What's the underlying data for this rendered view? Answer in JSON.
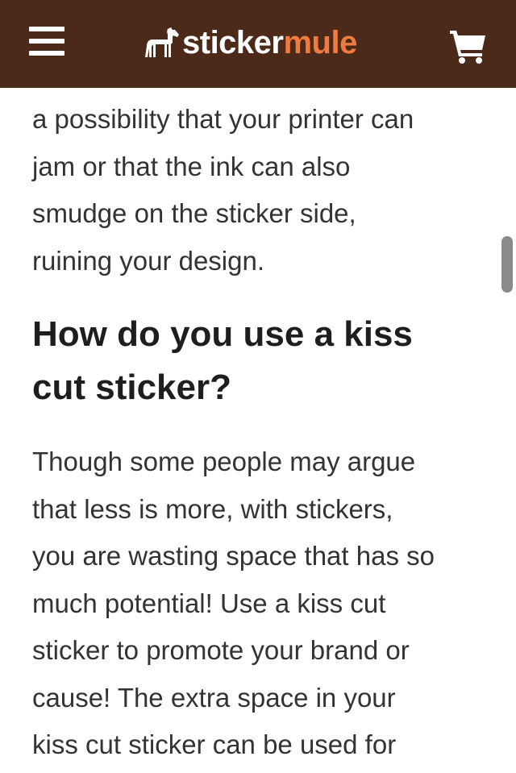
{
  "header": {
    "brand_part1": "sticker",
    "brand_part2": "mule",
    "brand_color": "#4b2a1a",
    "accent_color": "#f07b3f",
    "icons": {
      "menu": "hamburger-menu-icon",
      "logo": "horse-icon",
      "cart": "shopping-cart-icon"
    }
  },
  "article": {
    "para_top_lines": [
      "a possibility that your printer can",
      "jam or that the ink can also",
      "smudge on the sticker side,",
      "ruining your design."
    ],
    "heading_lines": [
      "How do you use a kiss",
      "cut sticker?"
    ],
    "para_bottom_lines": [
      "Though some people may argue",
      "that less is more, with stickers,",
      "you are wasting space that has so",
      "much potential! Use a kiss cut",
      "sticker to promote your brand or",
      "cause! The extra space in your",
      "kiss cut sticker can be used for"
    ]
  }
}
